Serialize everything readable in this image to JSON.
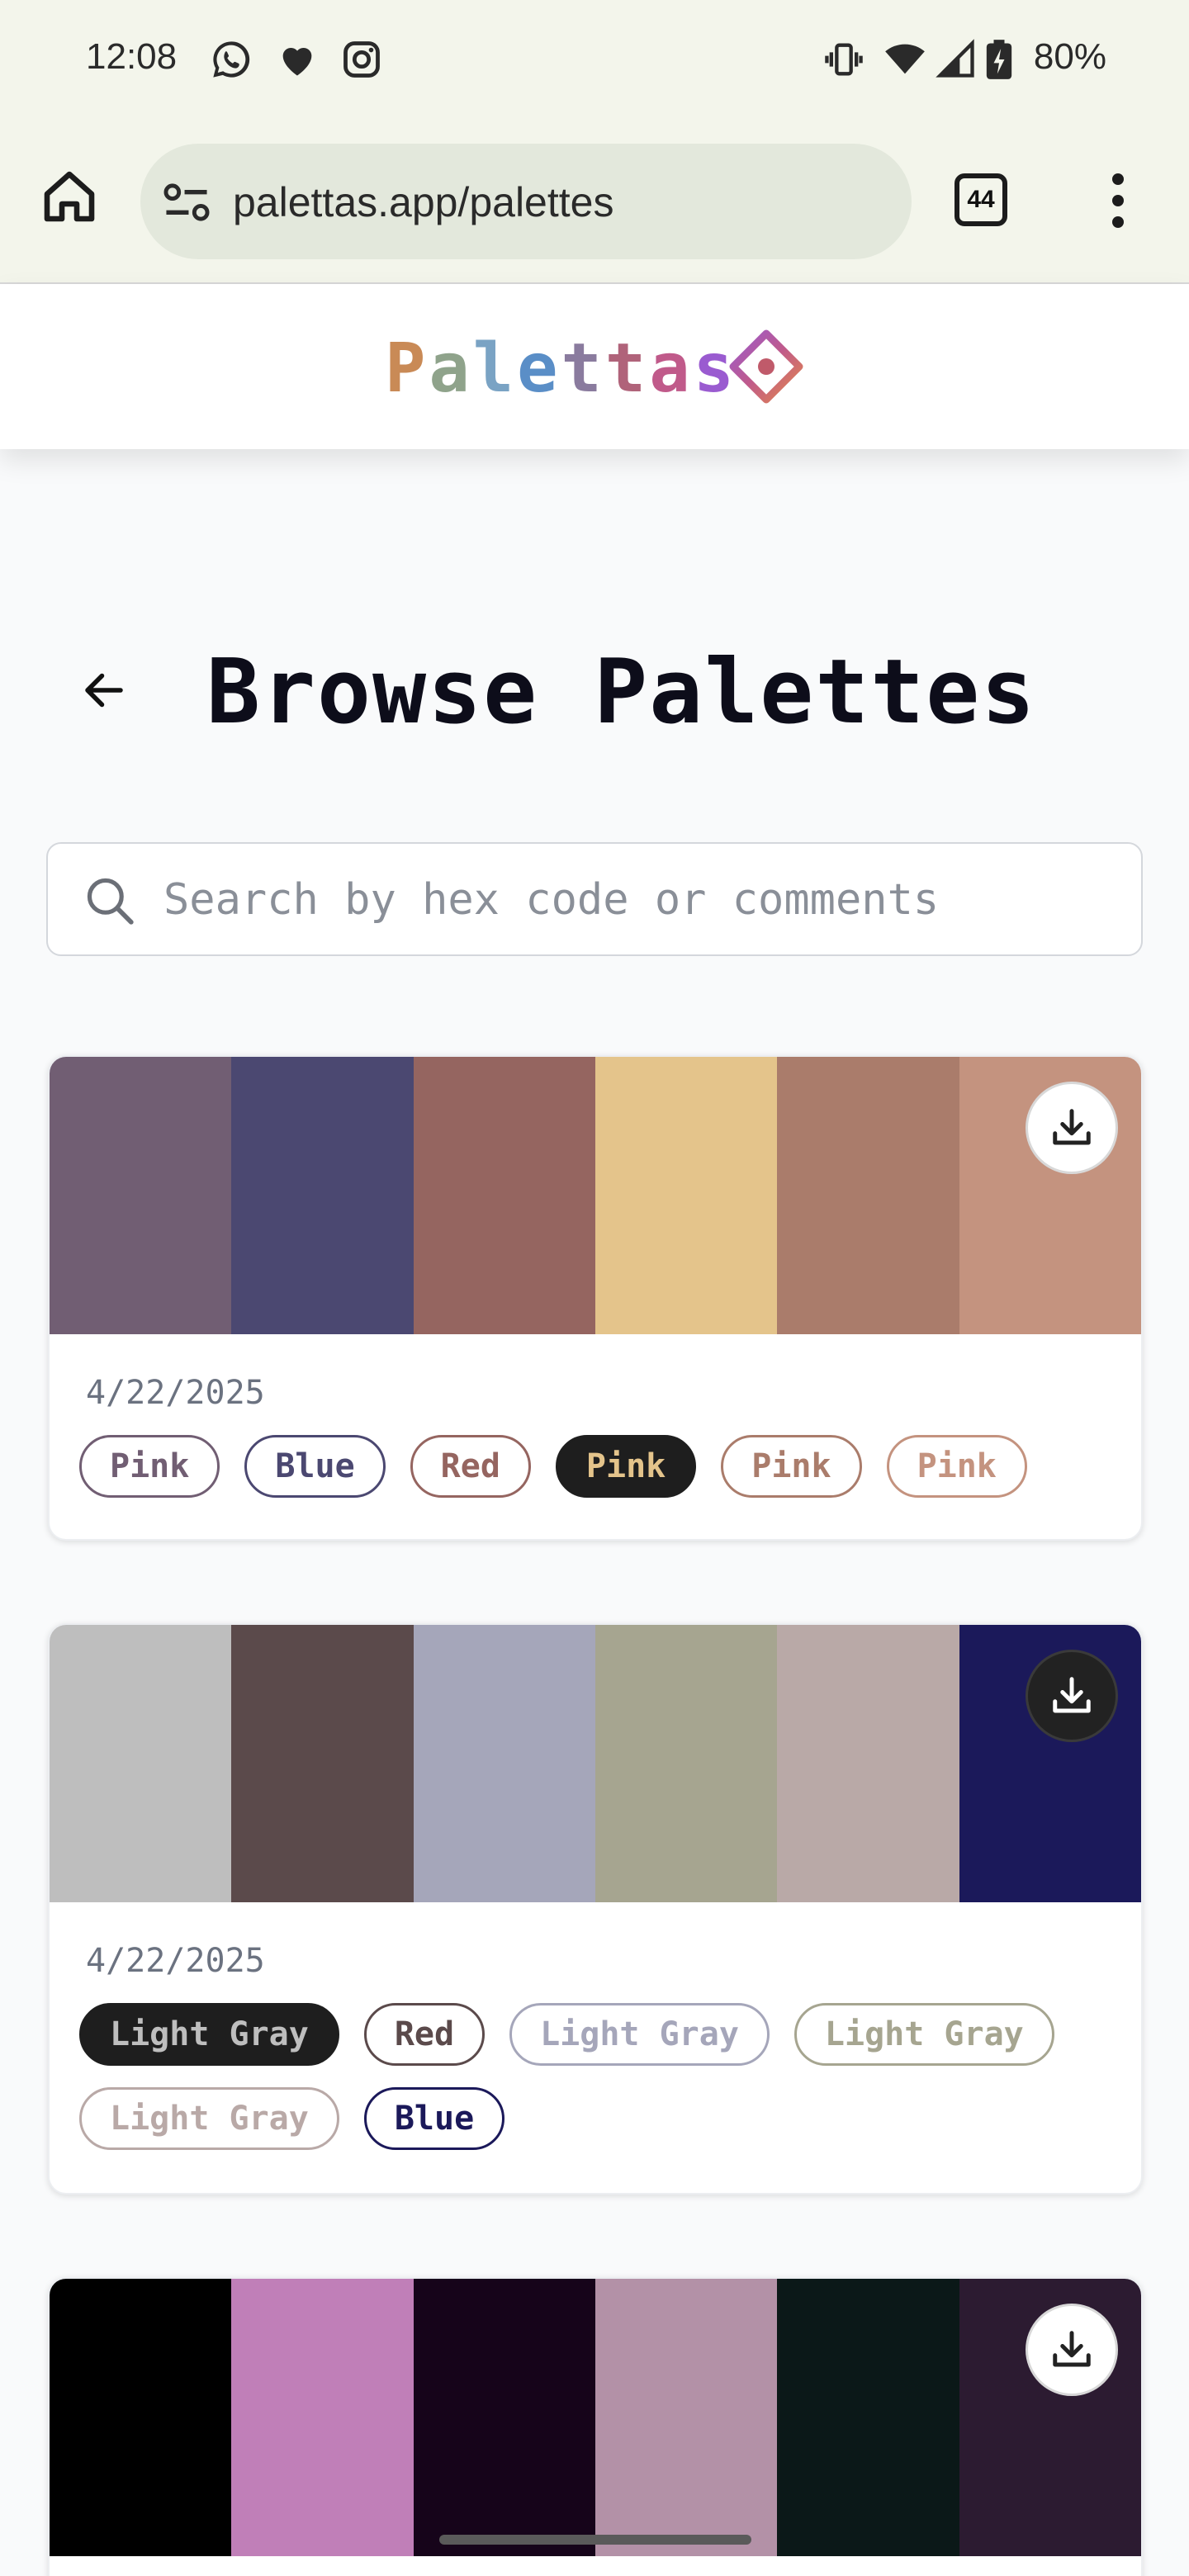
{
  "status_bar": {
    "time": "12:08",
    "battery": "80%",
    "icons": [
      "whatsapp-icon",
      "heart-icon",
      "instagram-icon",
      "vibrate-icon",
      "wifi-icon",
      "signal-icon",
      "battery-icon"
    ]
  },
  "browser": {
    "url": "palettas.app/palettes",
    "tab_count": "44"
  },
  "app": {
    "logo_text": "Palettas",
    "logo_colors": [
      "#c98a56",
      "#8fa38b",
      "#7aa3c4",
      "#5a8ec7",
      "#8a7b9e",
      "#b0637a",
      "#c05a8a",
      "#9a5bd0"
    ]
  },
  "page": {
    "title": "Browse Palettes"
  },
  "search": {
    "placeholder": "Search by hex code or comments",
    "value": ""
  },
  "palettes": [
    {
      "date": "4/22/2025",
      "colors": [
        "#715e73",
        "#4b4871",
        "#956560",
        "#e4c48b",
        "#aa7c6b",
        "#c4937f"
      ],
      "download_style": "light",
      "tags": [
        {
          "label": "Pink",
          "color": "#715e73",
          "filled": false
        },
        {
          "label": "Blue",
          "color": "#4b4871",
          "filled": false
        },
        {
          "label": "Red",
          "color": "#956560",
          "filled": false
        },
        {
          "label": "Pink",
          "color": "#e4c48b",
          "filled": true
        },
        {
          "label": "Pink",
          "color": "#aa7c6b",
          "filled": false
        },
        {
          "label": "Pink",
          "color": "#c4937f",
          "filled": false
        }
      ]
    },
    {
      "date": "4/22/2025",
      "colors": [
        "#bebebe",
        "#5b4a4b",
        "#a5a6ba",
        "#a6a590",
        "#b9a9a7",
        "#1b195a"
      ],
      "download_style": "dark",
      "tags": [
        {
          "label": "Light Gray",
          "color": "#bebebe",
          "filled": true
        },
        {
          "label": "Red",
          "color": "#5b4a4b",
          "filled": false
        },
        {
          "label": "Light Gray",
          "color": "#a5a6ba",
          "filled": false
        },
        {
          "label": "Light Gray",
          "color": "#a6a590",
          "filled": false
        },
        {
          "label": "Light Gray",
          "color": "#b9a9a7",
          "filled": false
        },
        {
          "label": "Blue",
          "color": "#1b195a",
          "filled": false
        }
      ]
    },
    {
      "date": "",
      "colors": [
        "#000000",
        "#c07fb8",
        "#16041a",
        "#b391a7",
        "#0b1818",
        "#2c1b31"
      ],
      "download_style": "light",
      "tags": []
    }
  ]
}
